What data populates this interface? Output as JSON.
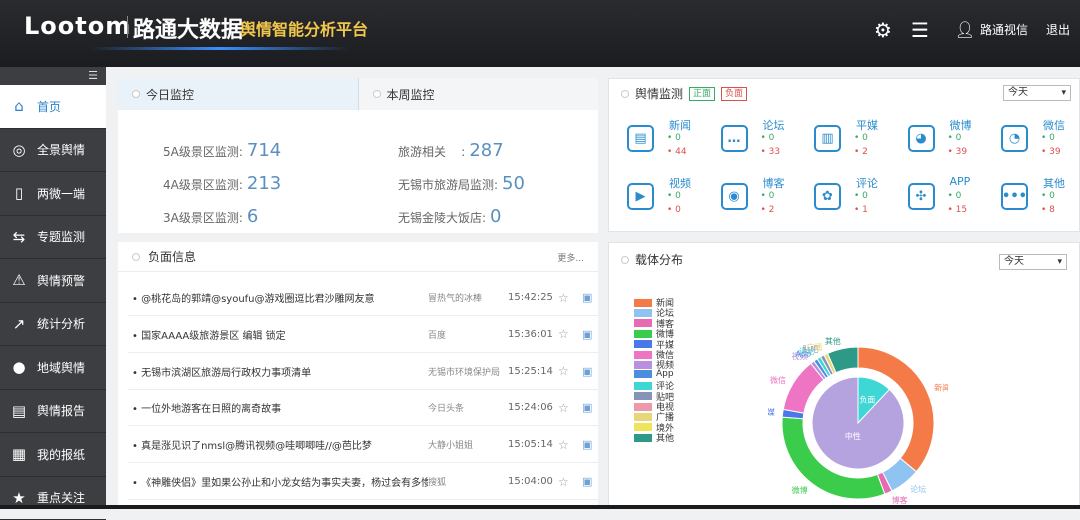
{
  "header": {
    "logo": "Lootom",
    "brand": "路通大数据",
    "subtitle": "舆情智能分析平台",
    "user": "路通视信",
    "logout": "退出"
  },
  "sidebar": {
    "items": [
      {
        "label": "首页",
        "icon": "home-icon",
        "glyph": "⌂"
      },
      {
        "label": "全景舆情",
        "icon": "target-icon",
        "glyph": "◎"
      },
      {
        "label": "两微一端",
        "icon": "phone-icon",
        "glyph": "▯"
      },
      {
        "label": "专题监测",
        "icon": "topic-icon",
        "glyph": "⇆"
      },
      {
        "label": "舆情预警",
        "icon": "alarm-icon",
        "glyph": "⚠"
      },
      {
        "label": "统计分析",
        "icon": "line-chart-icon",
        "glyph": "↗"
      },
      {
        "label": "地域舆情",
        "icon": "map-pin-icon",
        "glyph": "●"
      },
      {
        "label": "舆情报告",
        "icon": "report-icon",
        "glyph": "▤"
      },
      {
        "label": "我的报纸",
        "icon": "newspaper-icon",
        "glyph": "▦"
      },
      {
        "label": "重点关注",
        "icon": "star-icon",
        "glyph": "★"
      }
    ]
  },
  "monitor": {
    "tabs": [
      "今日监控",
      "本周监控"
    ],
    "stats": [
      {
        "label": "5A级景区监测:",
        "value": "714"
      },
      {
        "label": "旅游相关    :",
        "value": "287"
      },
      {
        "label": "4A级景区监测:",
        "value": "213"
      },
      {
        "label": "无锡市旅游局监测:",
        "value": "50"
      },
      {
        "label": "3A级景区监测:",
        "value": "6"
      },
      {
        "label": "无锡金陵大饭店:",
        "value": "0"
      }
    ]
  },
  "negative": {
    "title": "负面信息",
    "more": "更多...",
    "rows": [
      {
        "title": "@桃花岛的郭靖@syoufu@游戏圈逗比君沙雕网友意",
        "source": "冒热气的冰棒",
        "time": "15:42:25"
      },
      {
        "title": "国家AAAA级旅游景区 编辑 锁定",
        "source": "百度",
        "time": "15:36:01"
      },
      {
        "title": "无锡市滨湖区旅游局行政权力事项清单",
        "source": "无锡市环境保护局",
        "time": "15:25:14"
      },
      {
        "title": "一位外地游客在日照的离奇故事",
        "source": "今日头条",
        "time": "15:24:06"
      },
      {
        "title": "真是涨见识了nmsl@腾讯视频@哇唧唧哇//@芭比梦",
        "source": "大静小姐姐",
        "time": "15:05:14"
      },
      {
        "title": "《神雕侠侣》里如果公孙止和小龙女结为事实夫妻，杨过会有多惨?",
        "source": "搜狐",
        "time": "15:04:00"
      }
    ]
  },
  "opinion": {
    "title": "舆情监测",
    "badge_pos": "正面",
    "badge_neg": "负面",
    "select": "今天",
    "channels": [
      {
        "name": "新闻",
        "pos": "0",
        "neg": "44",
        "glyph": "▤"
      },
      {
        "name": "论坛",
        "pos": "0",
        "neg": "33",
        "glyph": "…"
      },
      {
        "name": "平媒",
        "pos": "0",
        "neg": "2",
        "glyph": "▥"
      },
      {
        "name": "微博",
        "pos": "0",
        "neg": "39",
        "glyph": "◕"
      },
      {
        "name": "微信",
        "pos": "0",
        "neg": "39",
        "glyph": "◔"
      },
      {
        "name": "视频",
        "pos": "0",
        "neg": "0",
        "glyph": "▶"
      },
      {
        "name": "博客",
        "pos": "0",
        "neg": "2",
        "glyph": "◉"
      },
      {
        "name": "评论",
        "pos": "0",
        "neg": "1",
        "glyph": "✿"
      },
      {
        "name": "APP",
        "pos": "0",
        "neg": "15",
        "glyph": "✣"
      },
      {
        "name": "其他",
        "pos": "0",
        "neg": "8",
        "glyph": "•••"
      }
    ]
  },
  "carrier": {
    "title": "载体分布",
    "select": "今天",
    "legend": [
      {
        "name": "新闻",
        "color": "#f47b47"
      },
      {
        "name": "论坛",
        "color": "#8fc3f2"
      },
      {
        "name": "博客",
        "color": "#e66bb3"
      },
      {
        "name": "微博",
        "color": "#3bcc4c"
      },
      {
        "name": "平媒",
        "color": "#4a78e8"
      },
      {
        "name": "微信",
        "color": "#ee75c4"
      },
      {
        "name": "视频",
        "color": "#b98fe0"
      },
      {
        "name": "App",
        "color": "#4b8ee0"
      },
      {
        "name": "评论",
        "color": "#3fd6d6"
      },
      {
        "name": "贴吧",
        "color": "#8794b8"
      },
      {
        "name": "电视",
        "color": "#ec9aa9"
      },
      {
        "name": "广播",
        "color": "#e6d878"
      },
      {
        "name": "境外",
        "color": "#f0e45a"
      },
      {
        "name": "其他",
        "color": "#2c9a86"
      }
    ],
    "outer": [
      {
        "name": "新闻",
        "value": 44,
        "color": "#f47b47"
      },
      {
        "name": "论坛",
        "value": 8,
        "color": "#8fc3f2"
      },
      {
        "name": "博客",
        "value": 2,
        "color": "#e66bb3"
      },
      {
        "name": "微博",
        "value": 39,
        "color": "#3bcc4c"
      },
      {
        "name": "平媒",
        "value": 2,
        "color": "#4a78e8"
      },
      {
        "name": "微信",
        "value": 14,
        "color": "#ee75c4"
      },
      {
        "name": "视频",
        "value": 1,
        "color": "#b98fe0"
      },
      {
        "name": "App",
        "value": 1,
        "color": "#4b8ee0"
      },
      {
        "name": "评论",
        "value": 1,
        "color": "#3fd6d6"
      },
      {
        "name": "贴吧",
        "value": 1,
        "color": "#8794b8"
      },
      {
        "name": "广播",
        "value": 1,
        "color": "#e6d878"
      },
      {
        "name": "其他",
        "value": 8,
        "color": "#2c9a86"
      }
    ],
    "inner": [
      {
        "name": "负面",
        "value": 12,
        "color": "#3fd6d6"
      },
      {
        "name": "中性",
        "value": 88,
        "color": "#b5a3e0"
      }
    ]
  }
}
